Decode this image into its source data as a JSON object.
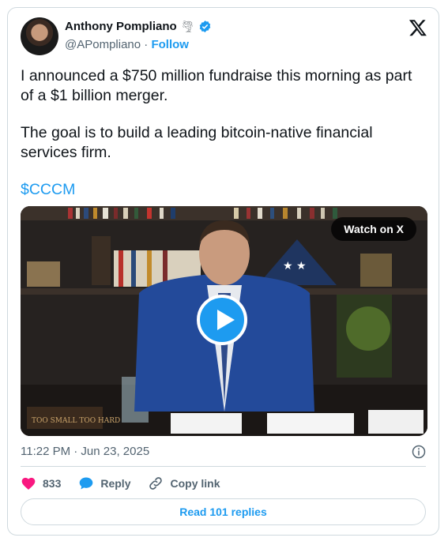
{
  "author": {
    "name": "Anthony Pompliano",
    "handle": "@APompliano",
    "separator": "·",
    "follow_label": "Follow"
  },
  "post": {
    "paragraphs": [
      "I announced a $750 million fundraise this morning as part of a $1 billion merger.",
      "The goal is to build a leading bitcoin-native financial services firm."
    ],
    "cashtag": "$CCCM",
    "timestamp": "11:22 PM · Jun 23, 2025"
  },
  "video": {
    "watch_label": "Watch on X"
  },
  "actions": {
    "likes": "833",
    "reply_label": "Reply",
    "copy_link_label": "Copy link"
  },
  "replies_button": "Read 101 replies",
  "colors": {
    "accent": "#1d9bf0",
    "like": "#f91880",
    "text": "#0f1419",
    "muted": "#536471",
    "border": "#cfd9de"
  }
}
